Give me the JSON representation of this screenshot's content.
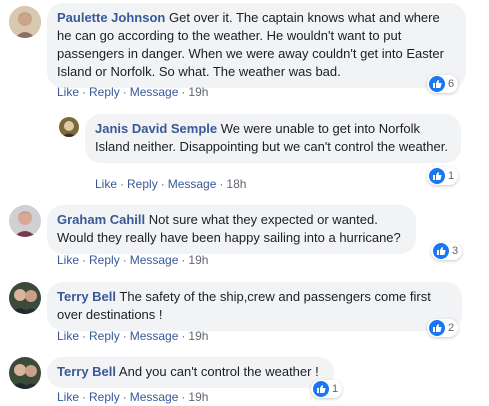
{
  "comments": [
    {
      "author": "Paulette Johnson",
      "text": "Get over it. The captain knows what and where he can go according to the weather. He wouldn't want to put passengers in danger. When we were away couldn't get into Easter Island or Norfolk. So what. The weather was bad.",
      "likes": "6",
      "like_label": "Like",
      "reply_label": "Reply",
      "message_label": "Message",
      "time": "19h"
    },
    {
      "author": "Janis David Semple",
      "text": "We were unable to get into Norfolk Island neither. Disappointing but we can't control the weather.",
      "likes": "1",
      "like_label": "Like",
      "reply_label": "Reply",
      "message_label": "Message",
      "time": "18h"
    },
    {
      "author": "Graham Cahill",
      "text": "Not sure what they expected or wanted. Would they really have been happy sailing into a hurricane?",
      "likes": "3",
      "like_label": "Like",
      "reply_label": "Reply",
      "message_label": "Message",
      "time": "19h"
    },
    {
      "author": "Terry Bell",
      "text": "The safety of the ship,crew and passengers come first over destinations !",
      "likes": "2",
      "like_label": "Like",
      "reply_label": "Reply",
      "message_label": "Message",
      "time": "19h"
    },
    {
      "author": "Terry Bell",
      "text": "And you can't control the weather !",
      "likes": "1",
      "like_label": "Like",
      "reply_label": "Reply",
      "message_label": "Message",
      "time": "19h"
    }
  ],
  "separator": "·",
  "colors": {
    "author_link": "#385898",
    "bubble_bg": "#f2f3f5",
    "like_blue": "#1877f2",
    "meta_gray": "#606770"
  }
}
